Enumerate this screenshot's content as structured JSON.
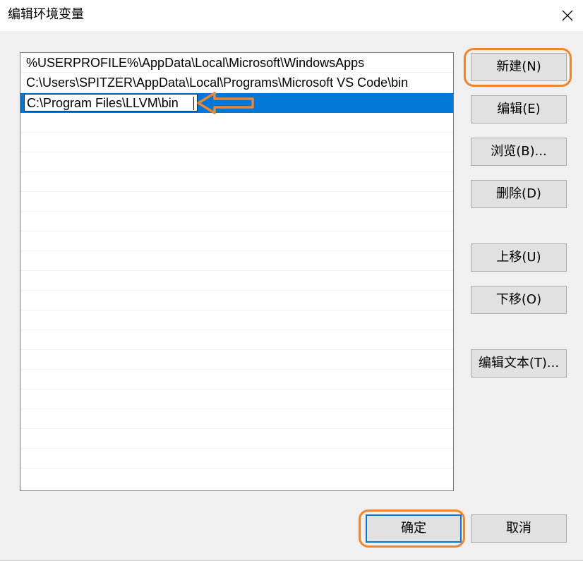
{
  "window": {
    "title": "编辑环境变量",
    "close_icon": "close-icon"
  },
  "list": {
    "items": [
      "%USERPROFILE%\\AppData\\Local\\Microsoft\\WindowsApps",
      "C:\\Users\\SPITZER\\AppData\\Local\\Programs\\Microsoft VS Code\\bin"
    ],
    "editing_value": "C:\\Program Files\\LLVM\\bin",
    "selection_color": "#0078d7"
  },
  "buttons": {
    "new": "新建(N)",
    "edit": "编辑(E)",
    "browse": "浏览(B)...",
    "delete": "删除(D)",
    "move_up": "上移(U)",
    "move_down": "下移(O)",
    "edit_text": "编辑文本(T)...",
    "ok": "确定",
    "cancel": "取消"
  },
  "annotations": {
    "highlight_color": "#f0852d",
    "arrow_icon": "left-arrow-icon"
  }
}
